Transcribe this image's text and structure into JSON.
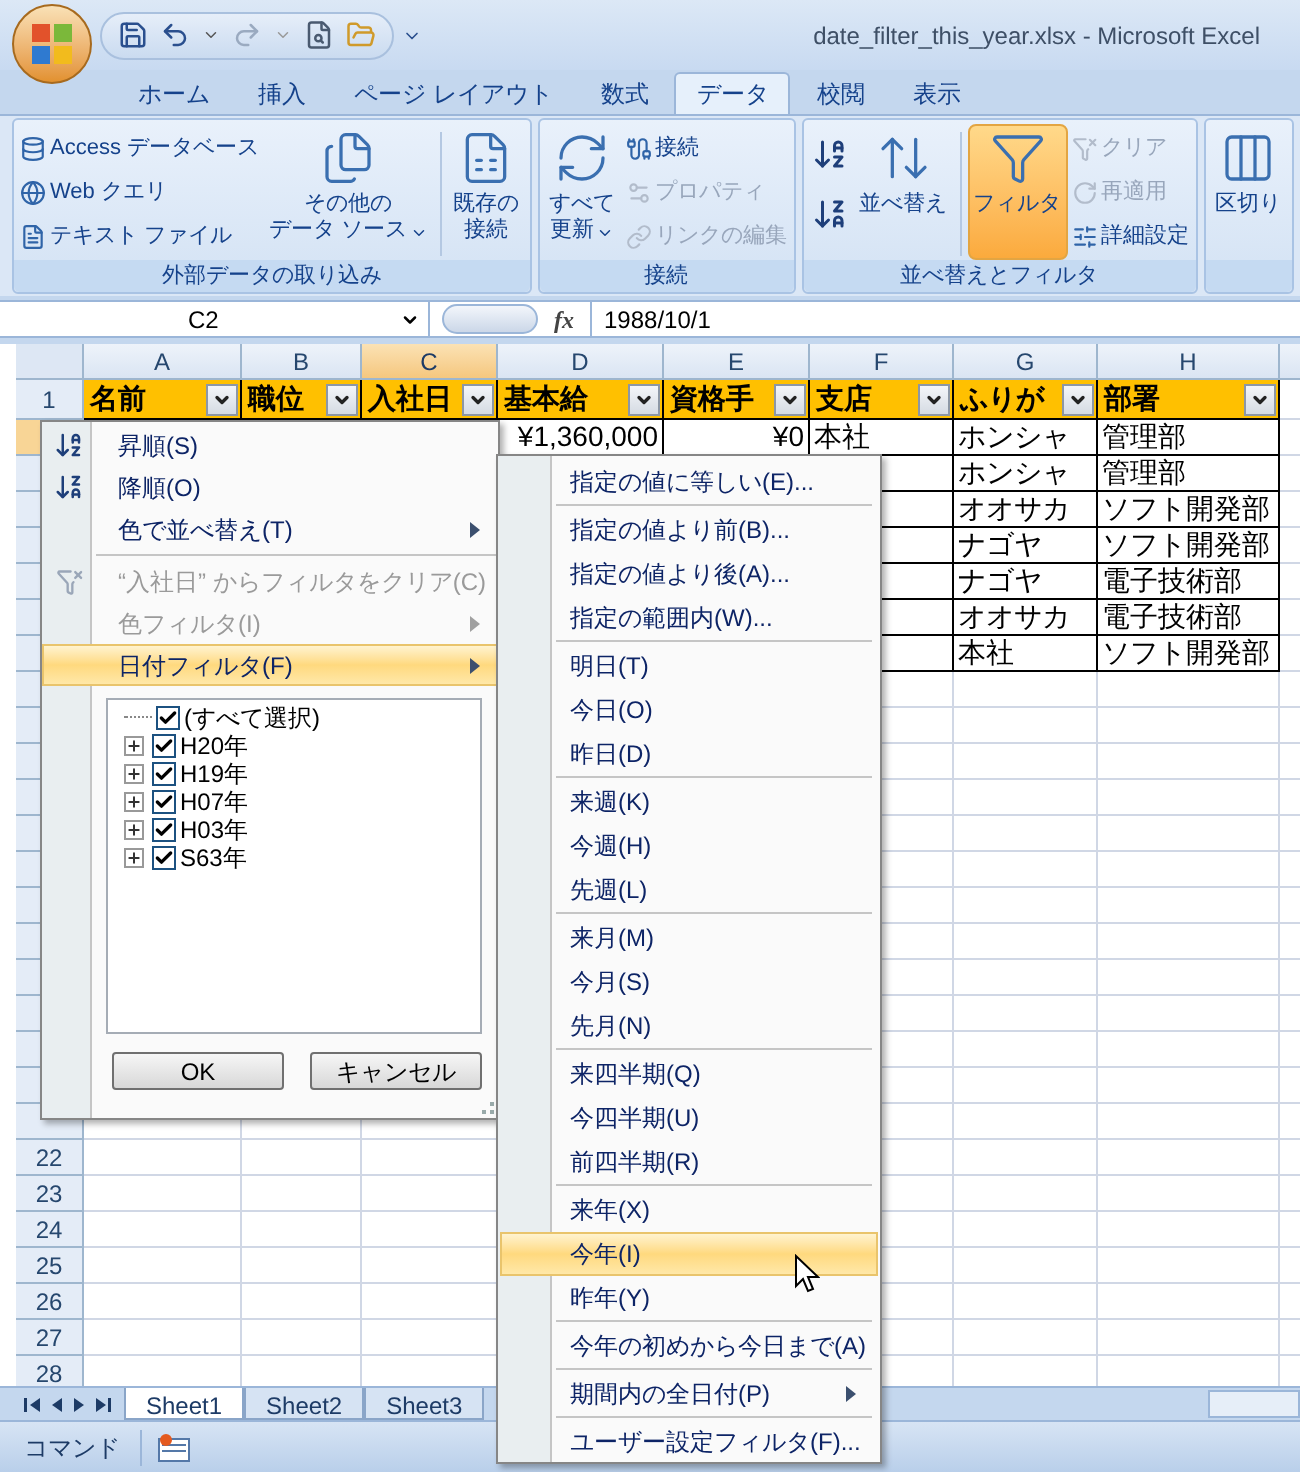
{
  "window": {
    "title": "date_filter_this_year.xlsx - Microsoft Excel"
  },
  "ribbon_tabs": [
    {
      "label": "ホーム",
      "selected": false
    },
    {
      "label": "挿入",
      "selected": false
    },
    {
      "label": "ページ レイアウト",
      "selected": false
    },
    {
      "label": "数式",
      "selected": false
    },
    {
      "label": "データ",
      "selected": true
    },
    {
      "label": "校閲",
      "selected": false
    },
    {
      "label": "表示",
      "selected": false
    }
  ],
  "ribbon_groups": [
    {
      "label": "外部データの取り込み",
      "columns": [
        {
          "kind": "stack",
          "items": [
            {
              "label": "Access データベース",
              "disabled": false
            },
            {
              "label": "Web クエリ",
              "disabled": false
            },
            {
              "label": "テキスト ファイル",
              "disabled": false
            }
          ]
        },
        {
          "kind": "large",
          "lines": [
            "その他の",
            "データ ソース"
          ],
          "dropdown": true,
          "selected": false
        },
        {
          "kind": "separator"
        },
        {
          "kind": "large",
          "lines": [
            "既存の",
            "接続"
          ],
          "dropdown": false,
          "selected": false
        }
      ]
    },
    {
      "label": "接続",
      "columns": [
        {
          "kind": "large",
          "lines": [
            "すべて",
            "更新"
          ],
          "dropdown": true,
          "selected": false
        },
        {
          "kind": "stack",
          "items": [
            {
              "label": "接続",
              "disabled": false
            },
            {
              "label": "プロパティ",
              "disabled": true
            },
            {
              "label": "リンクの編集",
              "disabled": true
            }
          ]
        }
      ]
    },
    {
      "label": "並べ替えとフィルタ",
      "columns": [
        {
          "kind": "sort_icons"
        },
        {
          "kind": "large",
          "lines": [
            "並べ替え"
          ],
          "dropdown": false,
          "selected": false
        },
        {
          "kind": "separator"
        },
        {
          "kind": "large",
          "lines": [
            "フィルタ"
          ],
          "dropdown": false,
          "selected": true
        },
        {
          "kind": "stack",
          "items": [
            {
              "label": "クリア",
              "disabled": true
            },
            {
              "label": "再適用",
              "disabled": true
            },
            {
              "label": "詳細設定",
              "disabled": false
            }
          ]
        }
      ]
    },
    {
      "columns": [
        {
          "kind": "large",
          "lines": [
            "区切り"
          ],
          "dropdown": false,
          "selected": false
        }
      ]
    }
  ],
  "formula_bar": {
    "name_box": "C2",
    "function_button": "fx",
    "formula": "1988/10/1"
  },
  "columns": [
    {
      "label": "A",
      "selected": false
    },
    {
      "label": "B",
      "selected": false
    },
    {
      "label": "C",
      "selected": true
    },
    {
      "label": "D",
      "selected": false
    },
    {
      "label": "E",
      "selected": false
    },
    {
      "label": "F",
      "selected": false
    },
    {
      "label": "G",
      "selected": false
    },
    {
      "label": "H",
      "selected": false
    }
  ],
  "rows": [
    {
      "number": "1",
      "kind": "header",
      "selected": false,
      "cells": {
        "A": "名前",
        "B": "職位",
        "C": "入社日",
        "D": "基本給",
        "E": "資格手",
        "F": "支店",
        "G": "ふりが",
        "H": "部署"
      }
    },
    {
      "kind": "table",
      "selected": true,
      "cells": {
        "D": "¥1,360,000",
        "E": "¥0",
        "F": "本社",
        "G": "ホンシャ",
        "H": "管理部"
      }
    },
    {
      "kind": "table",
      "selected": false,
      "cells": {
        "G": "ホンシャ",
        "H": "管理部"
      }
    },
    {
      "kind": "table",
      "selected": false,
      "cells": {
        "G": "オオサカ",
        "H": "ソフト開発部"
      }
    },
    {
      "kind": "table",
      "selected": false,
      "cells": {
        "G": "ナゴヤ",
        "H": "ソフト開発部"
      }
    },
    {
      "kind": "table",
      "selected": false,
      "cells": {
        "G": "ナゴヤ",
        "H": "電子技術部"
      }
    },
    {
      "kind": "table",
      "selected": false,
      "cells": {
        "G": "オオサカ",
        "H": "電子技術部"
      }
    },
    {
      "kind": "table",
      "selected": false,
      "cells": {
        "G": "本社",
        "H": "ソフト開発部"
      }
    },
    {
      "kind": "empty",
      "selected": false,
      "cells": {}
    },
    {
      "kind": "empty",
      "selected": false,
      "cells": {}
    },
    {
      "kind": "empty",
      "selected": false,
      "cells": {}
    },
    {
      "kind": "empty",
      "selected": false,
      "cells": {}
    },
    {
      "kind": "empty",
      "selected": false,
      "cells": {}
    },
    {
      "kind": "empty",
      "selected": false,
      "cells": {}
    },
    {
      "kind": "empty",
      "selected": false,
      "cells": {}
    },
    {
      "kind": "empty",
      "selected": false,
      "cells": {}
    },
    {
      "kind": "empty",
      "selected": false,
      "cells": {}
    },
    {
      "kind": "empty",
      "selected": false,
      "cells": {}
    },
    {
      "kind": "empty",
      "selected": false,
      "cells": {}
    },
    {
      "kind": "empty",
      "selected": false,
      "cells": {}
    },
    {
      "kind": "empty",
      "selected": false,
      "cells": {}
    },
    {
      "number": "22",
      "kind": "empty",
      "selected": false,
      "cells": {}
    },
    {
      "number": "23",
      "kind": "empty",
      "selected": false,
      "cells": {}
    },
    {
      "number": "24",
      "kind": "empty",
      "selected": false,
      "cells": {}
    },
    {
      "number": "25",
      "kind": "empty",
      "selected": false,
      "cells": {}
    },
    {
      "number": "26",
      "kind": "empty",
      "selected": false,
      "cells": {}
    },
    {
      "number": "27",
      "kind": "empty",
      "selected": false,
      "cells": {}
    },
    {
      "number": "28",
      "kind": "empty",
      "selected": false,
      "cells": {}
    }
  ],
  "filter_menu": {
    "sections": [
      [
        {
          "label": "昇順(S)",
          "kind": "sort_asc",
          "disabled": false,
          "selected": false
        },
        {
          "label": "降順(O)",
          "kind": "sort_desc",
          "disabled": false,
          "selected": false
        },
        {
          "label": "色で並べ替え(T)",
          "kind": "submenu",
          "disabled": false,
          "selected": false
        }
      ],
      [
        {
          "label": "“入社日” からフィルタをクリア(C)",
          "kind": "clear",
          "disabled": true,
          "selected": false
        },
        {
          "label": "色フィルタ(I)",
          "kind": "submenu",
          "disabled": true,
          "selected": false
        },
        {
          "label": "日付フィルタ(F)",
          "kind": "submenu",
          "disabled": false,
          "selected": true
        }
      ]
    ],
    "tree": {
      "label": "(すべて選択)",
      "checked": true,
      "children": [
        {
          "label": "H20年",
          "checked": true,
          "expanded": false
        },
        {
          "label": "H19年",
          "checked": true,
          "expanded": false
        },
        {
          "label": "H07年",
          "checked": true,
          "expanded": false
        },
        {
          "label": "H03年",
          "checked": true,
          "expanded": false
        },
        {
          "label": "S63年",
          "checked": true,
          "expanded": false
        }
      ]
    },
    "buttons": [
      "OK",
      "キャンセル"
    ]
  },
  "date_filter_menu": {
    "sections": [
      [
        {
          "label": "指定の値に等しい(E)...",
          "kind": "command",
          "selected": false
        }
      ],
      [
        {
          "label": "指定の値より前(B)...",
          "kind": "command",
          "selected": false
        },
        {
          "label": "指定の値より後(A)...",
          "kind": "command",
          "selected": false
        },
        {
          "label": "指定の範囲内(W)...",
          "kind": "command",
          "selected": false
        }
      ],
      [
        {
          "label": "明日(T)",
          "kind": "command",
          "selected": false
        },
        {
          "label": "今日(O)",
          "kind": "command",
          "selected": false
        },
        {
          "label": "昨日(D)",
          "kind": "command",
          "selected": false
        }
      ],
      [
        {
          "label": "来週(K)",
          "kind": "command",
          "selected": false
        },
        {
          "label": "今週(H)",
          "kind": "command",
          "selected": false
        },
        {
          "label": "先週(L)",
          "kind": "command",
          "selected": false
        }
      ],
      [
        {
          "label": "来月(M)",
          "kind": "command",
          "selected": false
        },
        {
          "label": "今月(S)",
          "kind": "command",
          "selected": false
        },
        {
          "label": "先月(N)",
          "kind": "command",
          "selected": false
        }
      ],
      [
        {
          "label": "来四半期(Q)",
          "kind": "command",
          "selected": false
        },
        {
          "label": "今四半期(U)",
          "kind": "command",
          "selected": false
        },
        {
          "label": "前四半期(R)",
          "kind": "command",
          "selected": false
        }
      ],
      [
        {
          "label": "来年(X)",
          "kind": "command",
          "selected": false
        },
        {
          "label": "今年(I)",
          "kind": "command",
          "selected": true
        },
        {
          "label": "昨年(Y)",
          "kind": "command",
          "selected": false
        }
      ],
      [
        {
          "label": "今年の初めから今日まで(A)",
          "kind": "command",
          "selected": false
        }
      ],
      [
        {
          "label": "期間内の全日付(P)",
          "kind": "submenu",
          "selected": false
        }
      ],
      [
        {
          "label": "ユーザー設定フィルタ(F)...",
          "kind": "command",
          "selected": false
        }
      ]
    ]
  },
  "sheet_tabs": [
    {
      "label": "Sheet1",
      "selected": true
    },
    {
      "label": "Sheet2",
      "selected": false
    },
    {
      "label": "Sheet3",
      "selected": false
    }
  ],
  "status_bar": {
    "mode": "コマンド"
  }
}
